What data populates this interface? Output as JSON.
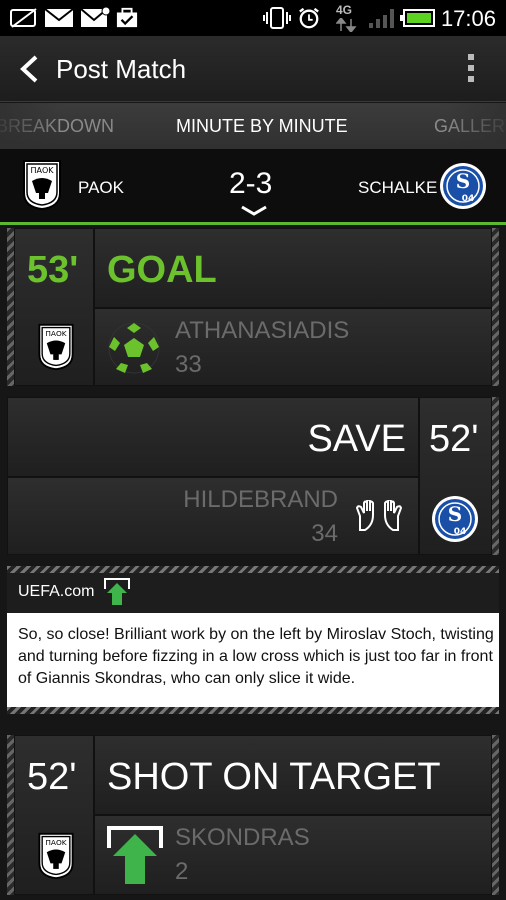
{
  "status_bar": {
    "time": "17:06",
    "network": "4G",
    "icons": [
      "no-sim-icon",
      "mail-icon",
      "mail-alert-icon",
      "task-check-icon",
      "vibrate-icon",
      "alarm-icon",
      "signal-icon",
      "battery-icon"
    ]
  },
  "header": {
    "title": "Post Match",
    "back_icon": "chevron-left-icon",
    "menu_icon": "overflow-menu-icon"
  },
  "tabs": [
    {
      "label": "BREAKDOWN",
      "state": "partial-left"
    },
    {
      "label": "MINUTE BY MINUTE",
      "state": "active"
    },
    {
      "label": "GALLERY",
      "state": "partial-right"
    }
  ],
  "match": {
    "home": "PAOK",
    "away": "SCHALKE",
    "score": "2-3",
    "home_crest_text": "ΠΑΟΚ",
    "away_crest_text": "04"
  },
  "events": [
    {
      "minute": "53'",
      "type": "GOAL",
      "player": "ATHANASIADIS",
      "number": "33",
      "icon": "football-icon",
      "team": "PAOK"
    },
    {
      "minute": "52'",
      "type": "SAVE",
      "player": "HILDEBRAND",
      "number": "34",
      "icon": "goalkeeper-gloves-icon",
      "team": "SCHALKE"
    },
    {
      "minute": "52'",
      "type": "SHOT ON TARGET",
      "player": "SKONDRAS",
      "number": "2",
      "icon": "shot-on-target-icon",
      "team": "PAOK"
    }
  ],
  "commentary": {
    "source": "UEFA.com",
    "text": "So, so close! Brilliant work by on the left by Miroslav Stoch, twisting and turning before fizzing in a low cross which is just too far in front of Giannis Skondras, who can only slice it wide."
  },
  "colors": {
    "accent_green": "#6cc22d",
    "schalke_blue": "#1a4fa8",
    "background": "#161616"
  }
}
